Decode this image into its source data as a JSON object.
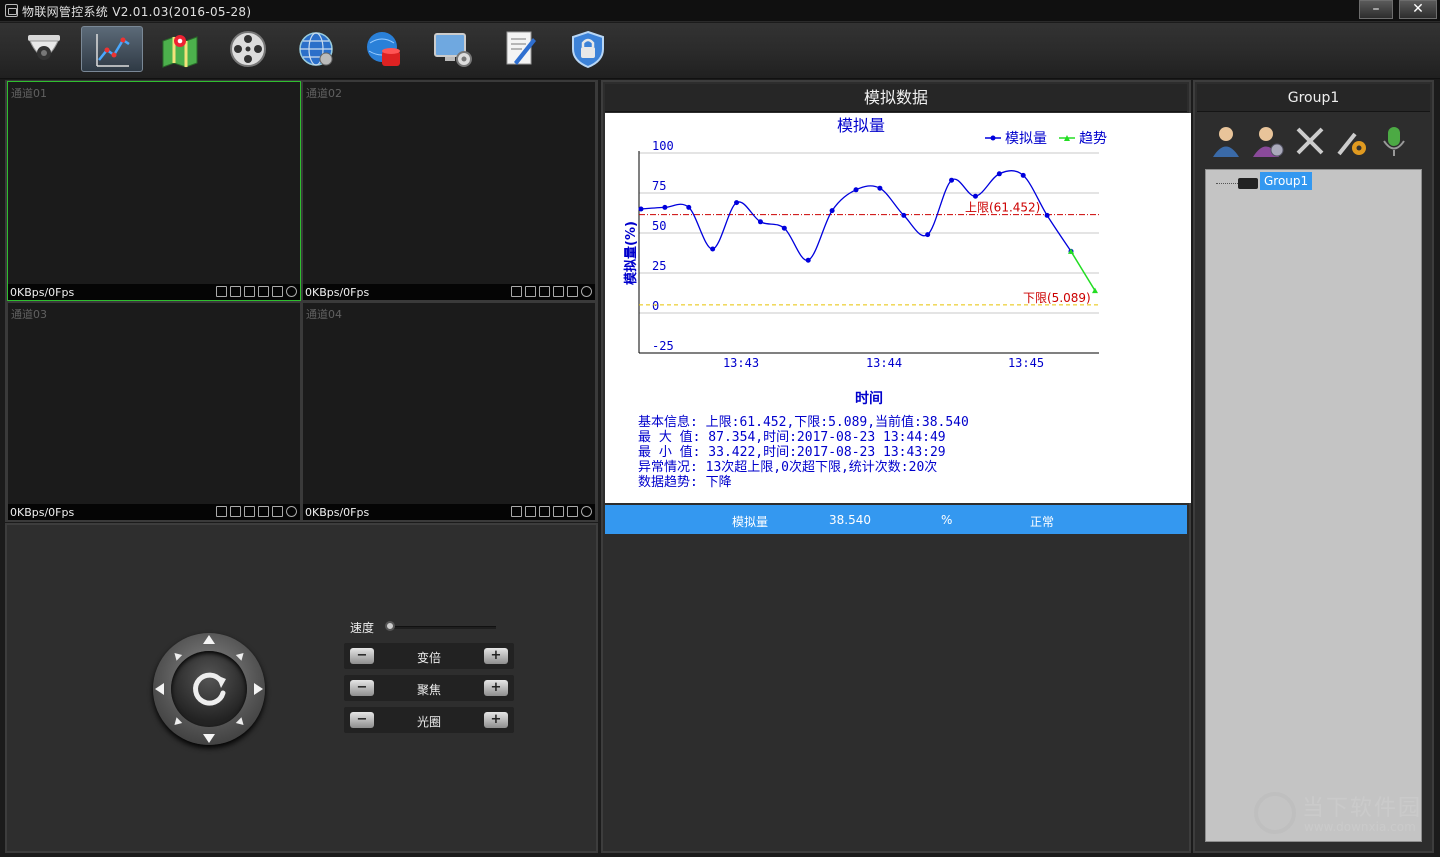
{
  "window": {
    "title": "物联网管控系统 V2.01.03(2016-05-28)",
    "minimize_label": "–",
    "close_label": "✕"
  },
  "toolbar": {
    "items": [
      {
        "icon": "dome-camera-icon",
        "active": false
      },
      {
        "icon": "line-chart-icon",
        "active": true
      },
      {
        "icon": "map-icon",
        "active": false
      },
      {
        "icon": "film-reel-icon",
        "active": false
      },
      {
        "icon": "network-globe-icon",
        "active": false
      },
      {
        "icon": "globe-database-icon",
        "active": false
      },
      {
        "icon": "monitor-settings-icon",
        "active": false
      },
      {
        "icon": "document-edit-icon",
        "active": false
      },
      {
        "icon": "security-lock-icon",
        "active": false
      }
    ]
  },
  "video": {
    "channels": [
      {
        "name": "通道01",
        "rate": "0KBps/0Fps",
        "selected": true
      },
      {
        "name": "通道02",
        "rate": "0KBps/0Fps",
        "selected": false
      },
      {
        "name": "通道03",
        "rate": "0KBps/0Fps",
        "selected": false
      },
      {
        "name": "通道04",
        "rate": "0KBps/0Fps",
        "selected": false
      }
    ]
  },
  "ptz": {
    "speed_label": "速度",
    "speed_value": 0,
    "zoom_label": "变倍",
    "focus_label": "聚焦",
    "iris_label": "光圈",
    "minus_label": "−",
    "plus_label": "+"
  },
  "sim": {
    "panel_title": "模拟数据",
    "info": {
      "line1": "基本信息: 上限:61.452,下限:5.089,当前值:38.540",
      "line2": "最  大  值: 87.354,时间:2017-08-23 13:44:49",
      "line3": "最  小  值: 33.422,时间:2017-08-23 13:43:29",
      "line4": "异常情况: 13次超上限,0次超下限,统计次数:20次",
      "line5": "数据趋势: 下降"
    },
    "row": {
      "name": "模拟量",
      "value": "38.540",
      "unit": "%",
      "status": "正常"
    }
  },
  "chart_data": {
    "type": "line",
    "title": "模拟量",
    "xlabel": "时间",
    "ylabel": "模拟量(%)",
    "ylim": [
      -25,
      100
    ],
    "yticks": [
      100,
      75,
      50,
      25,
      0,
      -25
    ],
    "xticks": [
      "13:43",
      "13:44",
      "13:45"
    ],
    "legend_position": "top-right",
    "upper_limit": {
      "value": 61.452,
      "label": "上限(61.452)",
      "color": "#cc0000"
    },
    "lower_limit": {
      "value": 5.089,
      "label": "下限(5.089)",
      "color": "#e6c200"
    },
    "series": [
      {
        "name": "模拟量",
        "color": "#0000dd",
        "values": [
          65,
          66,
          66,
          40,
          69,
          57,
          53,
          33,
          64,
          77,
          78,
          61,
          49,
          83,
          73,
          87,
          86,
          61,
          38.54
        ]
      },
      {
        "name": "趋势",
        "color": "#22dd22",
        "values": [
          38.54,
          14
        ]
      }
    ]
  },
  "group": {
    "title": "Group1",
    "tools": [
      "user-icon",
      "user-settings-icon",
      "tools-icon",
      "wrench-gear-icon",
      "microphone-icon"
    ],
    "tree_node": "Group1"
  },
  "watermark": {
    "main": "当下软件园",
    "sub": "www.downxia.com"
  }
}
